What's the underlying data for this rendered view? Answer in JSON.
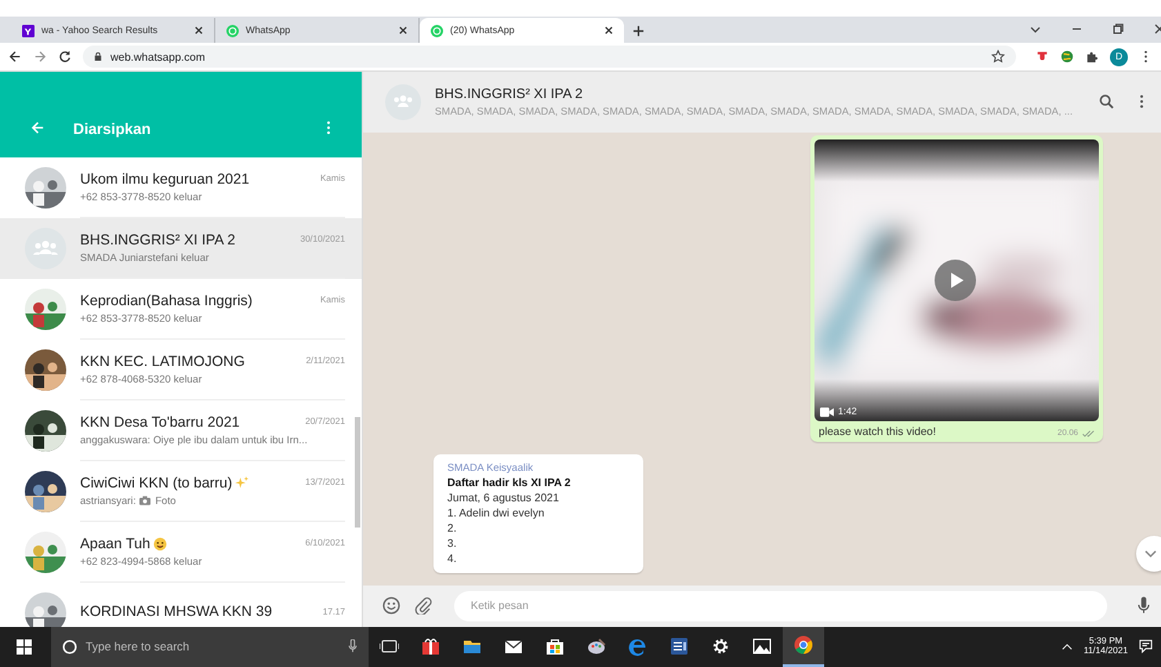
{
  "browser": {
    "tabs": [
      {
        "kind": "yahoo",
        "title": "wa - Yahoo Search Results",
        "selected": false
      },
      {
        "kind": "whatsapp",
        "title": "WhatsApp",
        "selected": false
      },
      {
        "kind": "whatsapp",
        "title": "(20) WhatsApp",
        "selected": true
      }
    ],
    "url": "web.whatsapp.com",
    "profile_initial": "D"
  },
  "sidebar": {
    "title": "Diarsipkan",
    "chats": [
      {
        "name": "Ukom ilmu keguruan 2021",
        "time": "Kamis",
        "preview": "+62 853-3778-8520 keluar",
        "selected": false
      },
      {
        "avatar": {
          "kind": "group"
        },
        "name": "BHS.INGGRIS² XI IPA 2",
        "time": "30/10/2021",
        "preview": "SMADA Juniarstefani keluar",
        "selected": true
      },
      {
        "name": "Keprodian(Bahasa Inggris)",
        "time": "Kamis",
        "preview": "+62 853-3778-8520 keluar",
        "selected": false
      },
      {
        "name": "KKN KEC. LATIMOJONG",
        "time": "2/11/2021",
        "preview": "+62 878-4068-5320 keluar",
        "selected": false
      },
      {
        "name": "KKN Desa To'barru 2021",
        "time": "20/7/2021",
        "preview": "anggakuswara: Oiye ple ibu dalam untuk ibu Irn...",
        "selected": false
      },
      {
        "name": "CiwiCiwi KKN (to barru)",
        "title_emoji": {
          "kind": "sparkles"
        },
        "time": "13/7/2021",
        "preview": "astriansyari:",
        "preview_media": "Foto",
        "selected": false
      },
      {
        "name": "Apaan Tuh",
        "title_emoji": {
          "kind": "face"
        },
        "time": "6/10/2021",
        "preview": "+62 823-4994-5868 keluar",
        "selected": false
      },
      {
        "name": "KORDINASI MHSWA KKN 39",
        "time": "17.17",
        "selected": false
      }
    ]
  },
  "chat": {
    "title": "BHS.INGGRIS² XI IPA 2",
    "members": "SMADA, SMADA, SMADA, SMADA, SMADA, SMADA, SMADA, SMADA, SMADA, SMADA, SMADA, SMADA, SMADA, SMADA, SMADA, ...",
    "messages": [
      {
        "kind": "video",
        "duration": "1:42",
        "caption": "please watch this video!",
        "time": "20.06"
      },
      {
        "kind": "text",
        "sender": "SMADA Keisyaalik",
        "heading": "Daftar hadir kls XI IPA 2",
        "lines": [
          "Jumat, 6 agustus 2021",
          "1. Adelin dwi evelyn",
          "2.",
          "3.",
          "4."
        ]
      }
    ],
    "composer": {
      "placeholder": "Ketik pesan"
    }
  },
  "taskbar": {
    "search_placeholder": "Type here to search",
    "apps": [
      {
        "kind": "task-view",
        "active": false
      },
      {
        "kind": "gift",
        "active": false
      },
      {
        "kind": "folder",
        "active": false
      },
      {
        "kind": "mail",
        "active": false
      },
      {
        "kind": "store",
        "active": false
      },
      {
        "kind": "paint",
        "active": false
      },
      {
        "kind": "edge",
        "active": false
      },
      {
        "kind": "word",
        "active": false
      },
      {
        "kind": "settings",
        "active": false
      },
      {
        "kind": "photos",
        "active": false
      },
      {
        "kind": "chrome",
        "active": true
      }
    ],
    "time": "5:39 PM",
    "date": "11/14/2021"
  }
}
